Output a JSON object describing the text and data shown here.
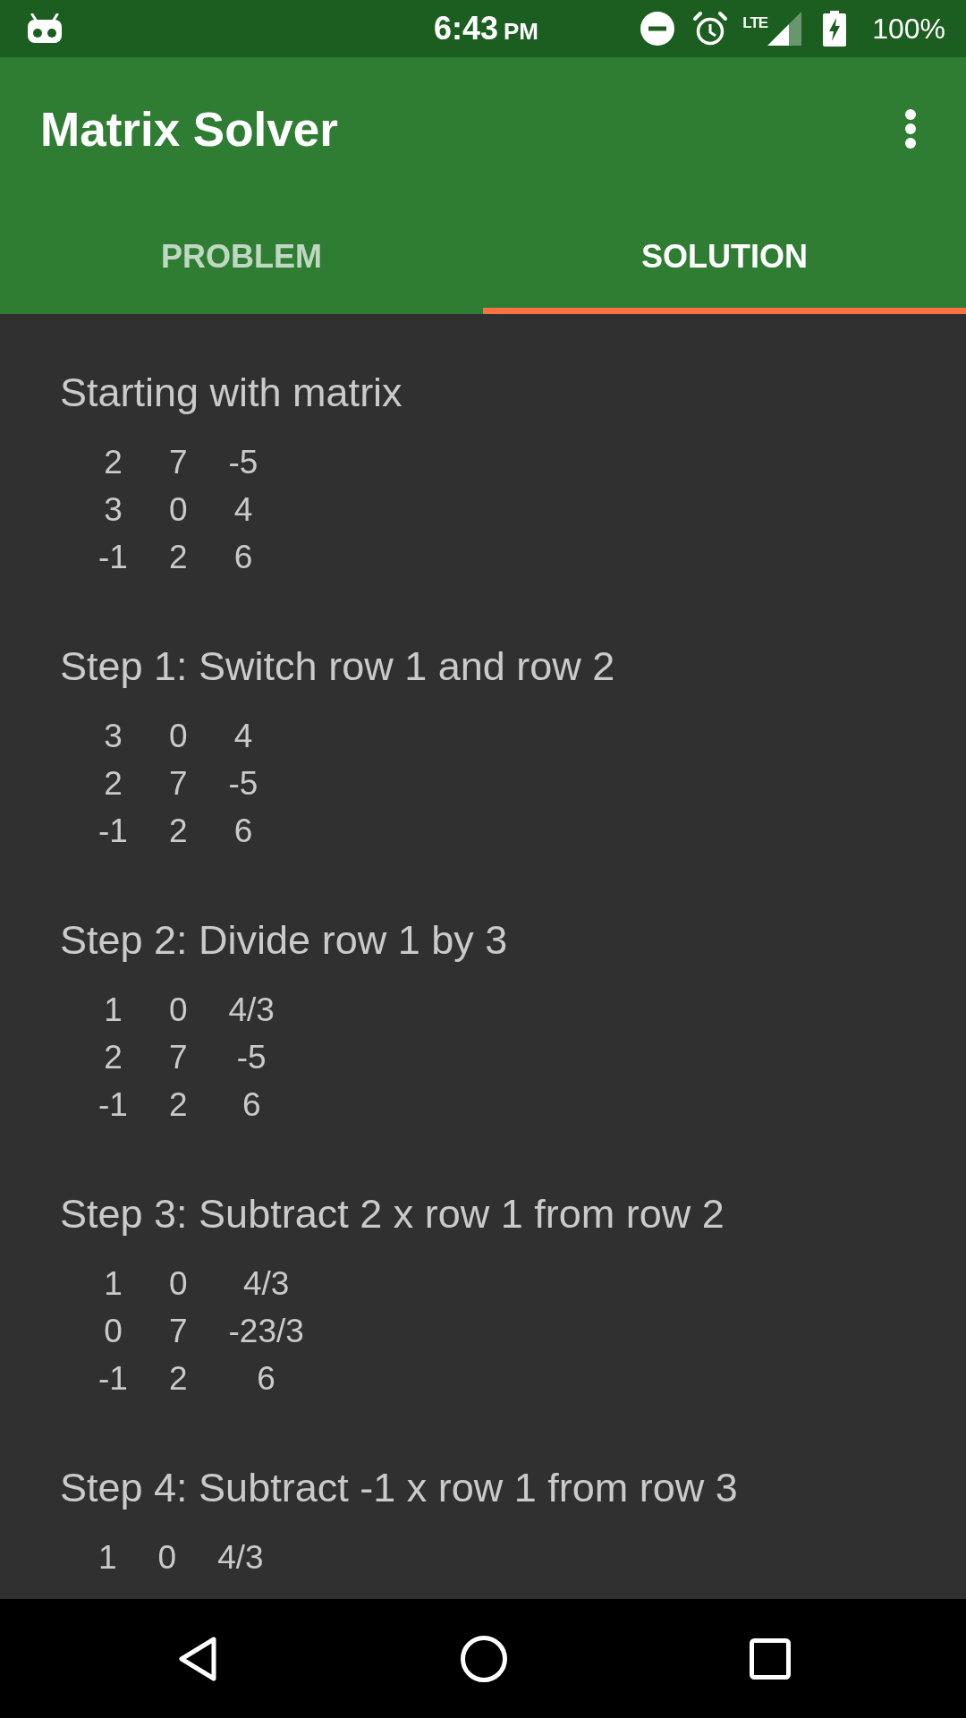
{
  "status_bar": {
    "time": "6:43",
    "period": "PM",
    "network": "LTE",
    "battery": "100%"
  },
  "app_bar": {
    "title": "Matrix Solver"
  },
  "tabs": [
    {
      "label": "PROBLEM",
      "selected": false
    },
    {
      "label": "SOLUTION",
      "selected": true
    }
  ],
  "steps": [
    {
      "title": "Starting with matrix",
      "rows": [
        [
          "2",
          "7",
          "-5"
        ],
        [
          "3",
          "0",
          "4"
        ],
        [
          "-1",
          "2",
          "6"
        ]
      ]
    },
    {
      "title": "Step 1: Switch row 1 and row 2",
      "rows": [
        [
          "3",
          "0",
          "4"
        ],
        [
          "2",
          "7",
          "-5"
        ],
        [
          "-1",
          "2",
          "6"
        ]
      ]
    },
    {
      "title": "Step 2: Divide row 1 by 3",
      "rows": [
        [
          "1",
          "0",
          "4/3"
        ],
        [
          "2",
          "7",
          "-5"
        ],
        [
          "-1",
          "2",
          "6"
        ]
      ]
    },
    {
      "title": "Step 3: Subtract 2 x row 1 from row 2",
      "rows": [
        [
          "1",
          "0",
          "4/3"
        ],
        [
          "0",
          "7",
          "-23/3"
        ],
        [
          "-1",
          "2",
          "6"
        ]
      ]
    },
    {
      "title": "Step 4: Subtract -1 x row 1 from row 3",
      "rows": [
        [
          "1",
          "0",
          "4/3"
        ]
      ]
    }
  ]
}
